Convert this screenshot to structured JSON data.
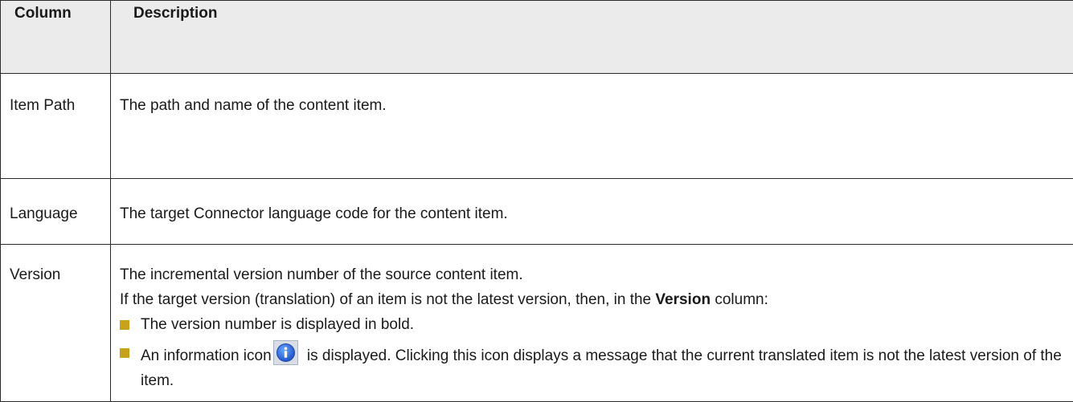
{
  "table": {
    "headers": {
      "column": "Column",
      "description": "Description"
    },
    "rows": {
      "item_path": {
        "label": "Item Path",
        "description": "The path and name of the content item."
      },
      "language": {
        "label": "Language",
        "description": "The target Connector language code for the content item."
      },
      "version": {
        "label": "Version",
        "line1": "The incremental version number of the source content item.",
        "line2_before": "If the target version (translation) of an item is not the latest version, then, in the ",
        "line2_bold": "Version",
        "line2_after": " column:",
        "bullet1": "The version number is displayed in bold.",
        "bullet2_before": "An information icon",
        "bullet2_after": " is displayed. Clicking this icon displays a message that the current translated item is not the latest version of the item.",
        "info_icon": "info-icon"
      }
    }
  },
  "colors": {
    "header_bg": "#ebebeb",
    "bullet": "#c8a21a",
    "info_icon_blue": "#2f6fd6"
  }
}
